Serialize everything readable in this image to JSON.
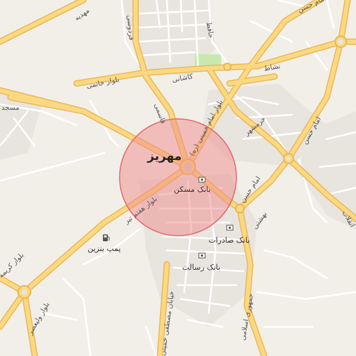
{
  "map": {
    "city_label": "مهریز",
    "labels": {
      "mahdieh": "مهدیه",
      "ferdowsi": "فردوسی",
      "hafez": "حافظ",
      "imam_hasan_top": "امام حسن",
      "nashat": "نشاط",
      "kashani": "کاشانی",
      "boulevard_khatami": "بلوار خاتمی",
      "masjed": "مسجد",
      "ghasemi": "قاسمی",
      "boulevard_imam_khomeini": "بلوار امام خمینی (ره)",
      "khorramshahr": "خرمشهر",
      "imam_hasan_right": "امام حسن",
      "imam_hasan_mid": "امام حسن",
      "boulevard_haft_tir": "بلوار هفتم تیر",
      "beheshti": "بهشتی",
      "boulevard_karimeh": "بلوار کریمه",
      "boulevard_valiasr": "بلوار ولیعصر",
      "mostafa_khomeini": "خیابان مصطفی خمینی",
      "jomhouri": "جمهوری اسلامی",
      "enghelab": "انقلاب"
    },
    "pois": [
      {
        "name": "بانک مسکن",
        "type": "bank"
      },
      {
        "name": "بانک صادرات",
        "type": "bank"
      },
      {
        "name": "بانک رسالت",
        "type": "bank"
      },
      {
        "name": "پمپ بنزین",
        "type": "fuel"
      }
    ],
    "colors": {
      "background": "#f2efe9",
      "main_road": "#fcd882",
      "main_road_casing": "#e8b955",
      "minor_road": "#ffffff",
      "park": "#c9e8b0",
      "highlight_circle_fill": "#f08c8c",
      "highlight_circle_stroke": "#e06a6a"
    }
  }
}
